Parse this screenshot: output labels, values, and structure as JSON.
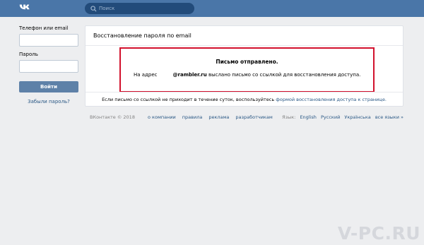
{
  "header": {
    "search_placeholder": "Поиск"
  },
  "login": {
    "phone_label": "Телефон или email",
    "password_label": "Пароль",
    "login_button": "Войти",
    "forgot_link": "Забыли пароль?"
  },
  "card": {
    "title": "Восстановление пароля по email",
    "sent_title": "Письмо отправлено.",
    "sent_prefix": "На адрес",
    "email": "@rambler.ru",
    "sent_suffix": "выслано письмо со ссылкой для восстановления доступа.",
    "footer_text": "Если письмо со ссылкой не приходит в течение суток, воспользуйтесь",
    "footer_link": "формой восстановления доступа к странице."
  },
  "footer": {
    "copyright": "ВКонтакте © 2018",
    "links": [
      "о компании",
      "правила",
      "реклама",
      "разработчикам"
    ],
    "language_label": "Язык:",
    "languages": [
      "English",
      "Русский",
      "Українська",
      "все языки »"
    ]
  },
  "watermark": "V-PC.RU",
  "colors": {
    "header": "#4a76a8",
    "background": "#edeef0",
    "highlight_box": "#d2112d",
    "link": "#2a5885"
  }
}
